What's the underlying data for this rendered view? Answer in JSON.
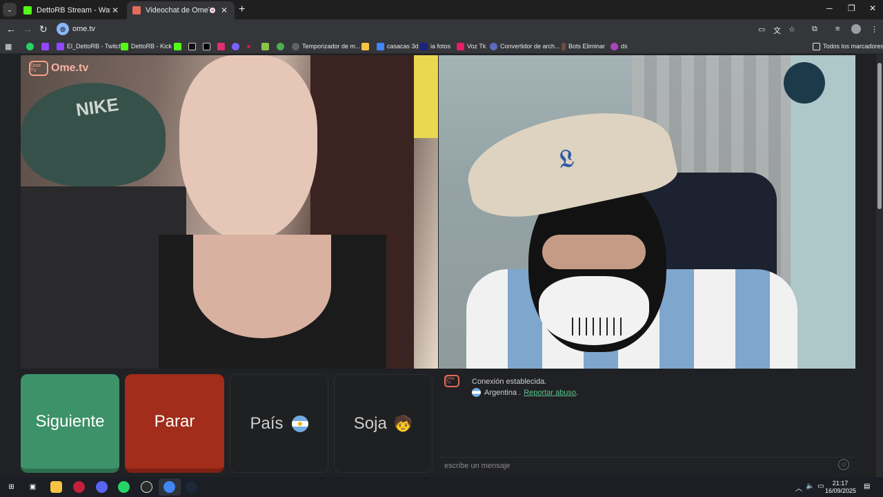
{
  "tabs": [
    {
      "title": "DettoRB Stream - Watch Live o",
      "favicon_color": "#53fc18"
    },
    {
      "title": "Videochat de OmeTV: una",
      "favicon_color": "#e36b5a"
    }
  ],
  "address": {
    "url": "ome.tv"
  },
  "bookmarks": [
    {
      "label": "",
      "color": "#25d366"
    },
    {
      "label": "",
      "color": "#9146ff"
    },
    {
      "label": "El_DettoRB - Twitch",
      "color": "#9146ff"
    },
    {
      "label": "DettoRB - Kick",
      "color": "#53fc18"
    },
    {
      "label": "",
      "color": "#53fc18"
    },
    {
      "label": "",
      "color": "#111111"
    },
    {
      "label": "",
      "color": "#000000"
    },
    {
      "label": "",
      "color": "#e1306c"
    },
    {
      "label": "",
      "color": "#7b61ff"
    },
    {
      "label": "",
      "color": "#c41e3a"
    },
    {
      "label": "",
      "color": "#8bc34a"
    },
    {
      "label": "",
      "color": "#4caf50"
    },
    {
      "label": "Temporizador de m...",
      "color": "#5f6368"
    },
    {
      "label": "",
      "color": "#f6c343"
    },
    {
      "label": "casacas 3d",
      "color": "#4285f4"
    },
    {
      "label": "ia fotos",
      "color": "#1a237e"
    },
    {
      "label": "Voz Tk",
      "color": "#e91e63"
    },
    {
      "label": "Convertidor de arch...",
      "color": "#5c6bc0"
    },
    {
      "label": "Bots Eliminar",
      "color": "#6d4c41"
    },
    {
      "label": "ds",
      "color": "#ab47bc"
    }
  ],
  "all_bookmarks_label": "Todos los marcadores",
  "logo": {
    "box": "Ome TV",
    "text": "Ome.tv"
  },
  "left_video": {
    "cap_logo": "NIKE"
  },
  "controls": {
    "next_label": "Siguiente",
    "stop_label": "Parar",
    "country_label": "País",
    "gender_label": "Soja",
    "gender_icon": "🧒"
  },
  "chat": {
    "logo": "Ome TV",
    "connection_text": "Conexión establecida.",
    "country": "Argentina .",
    "report_link": "Reportar abuso",
    "report_suffix": ".",
    "input_placeholder": "escribe un mensaje"
  },
  "clock": {
    "time": "21:17",
    "date": "16/09/2025"
  },
  "colors": {
    "next": "#3d9269",
    "stop": "#a12d1a",
    "accent": "#58c58c"
  }
}
